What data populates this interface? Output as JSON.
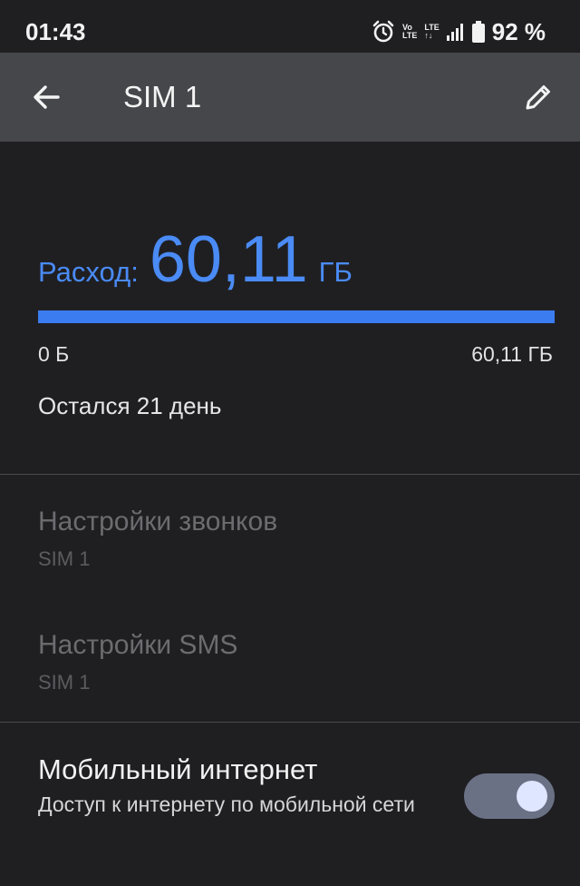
{
  "status_bar": {
    "time": "01:43",
    "volte_top": "Vo",
    "volte_bottom": "LTE",
    "lte_top": "LTE",
    "lte_bottom": "↑↓",
    "battery": "92 %"
  },
  "app_bar": {
    "title": "SIM 1",
    "back_icon": "arrow-left-icon",
    "edit_icon": "pencil-icon"
  },
  "usage": {
    "label": "Расход:",
    "value": "60,11",
    "unit": "ГБ",
    "progress_fraction": 1.0,
    "range_min": "0 Б",
    "range_max": "60,11 ГБ",
    "days_left": "Остался 21 день",
    "accent_color": "#4a8bf5"
  },
  "settings": [
    {
      "title": "Настройки звонков",
      "subtitle": "SIM 1"
    },
    {
      "title": "Настройки SMS",
      "subtitle": "SIM 1"
    }
  ],
  "mobile_internet": {
    "title": "Мобильный интернет",
    "description": "Доступ к интернету по мобильной сети",
    "enabled": true
  }
}
